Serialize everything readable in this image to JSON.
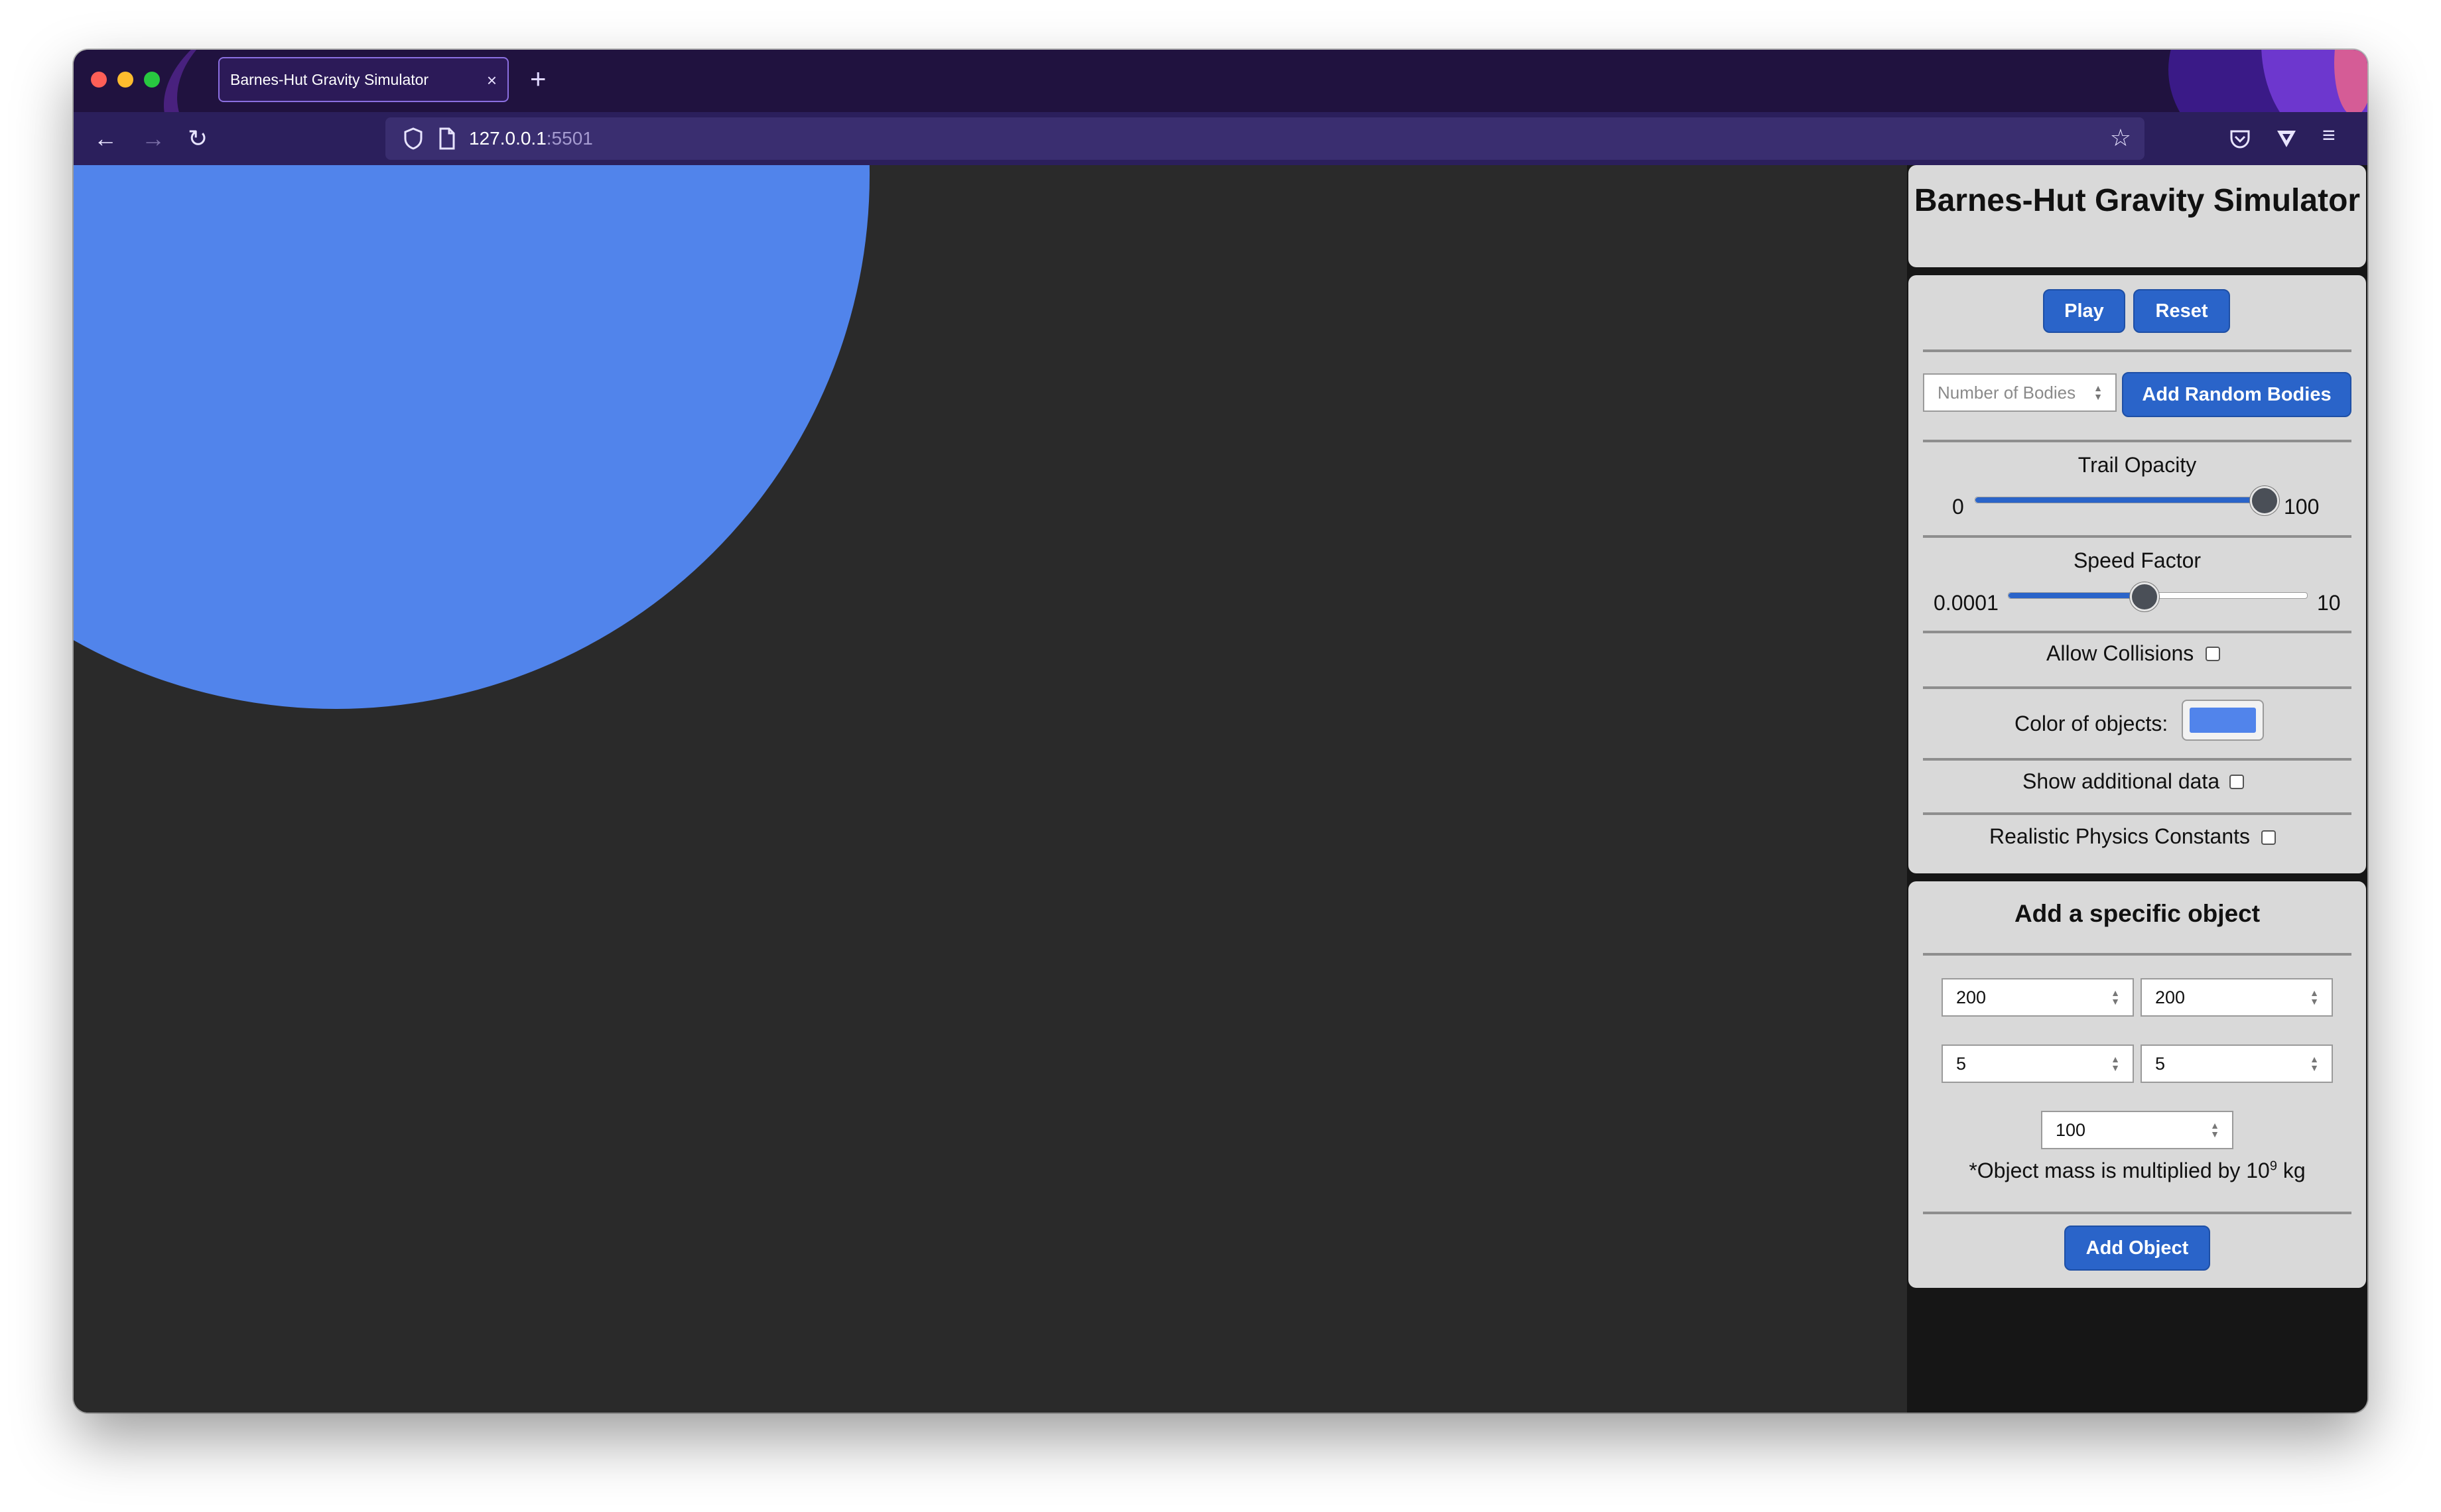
{
  "browser": {
    "tab_title": "Barnes-Hut Gravity Simulator",
    "tab_close": "×",
    "new_tab": "+",
    "url_host": "127.0.0.1",
    "url_port": ":5501"
  },
  "simulation": {
    "body_color": "#5184eb",
    "background_color": "#2a2a2a"
  },
  "panel": {
    "title": "Barnes-Hut Gravity Simulator",
    "play_label": "Play",
    "reset_label": "Reset",
    "num_bodies_placeholder": "Number of Bodies",
    "add_random_label": "Add Random Bodies",
    "trail_opacity": {
      "label": "Trail Opacity",
      "min": "0",
      "max": "100",
      "value": 100
    },
    "speed_factor": {
      "label": "Speed Factor",
      "min": "0.0001",
      "max": "10",
      "value_fraction": 0.45
    },
    "allow_collisions_label": "Allow Collisions",
    "allow_collisions_checked": false,
    "color_label": "Color of objects:",
    "color_value": "#5184eb",
    "show_additional_label": "Show additional data",
    "show_additional_checked": false,
    "realistic_label": "Realistic Physics Constants",
    "realistic_checked": false
  },
  "add_object": {
    "title": "Add a specific object",
    "pos_x": "200",
    "pos_y": "200",
    "vel_x": "5",
    "vel_y": "5",
    "mass": "100",
    "note_prefix": "*Object mass is multiplied by 10",
    "note_exp": "9",
    "note_suffix": " kg",
    "add_label": "Add Object"
  }
}
